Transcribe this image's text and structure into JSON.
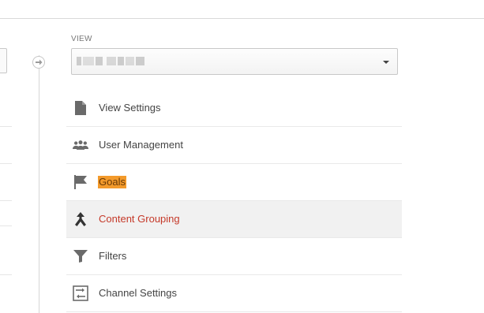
{
  "view": {
    "label": "VIEW",
    "selected_value_redacted": true
  },
  "menu": {
    "items": [
      {
        "label": "View Settings",
        "icon": "document-icon"
      },
      {
        "label": "User Management",
        "icon": "users-icon"
      },
      {
        "label": "Goals",
        "icon": "flag-icon",
        "highlighted": true
      },
      {
        "label": "Content Grouping",
        "icon": "content-grouping-icon",
        "selected": true
      },
      {
        "label": "Filters",
        "icon": "filter-icon"
      },
      {
        "label": "Channel Settings",
        "icon": "channel-settings-icon"
      }
    ]
  },
  "colors": {
    "active_text": "#c53929",
    "highlight": "#f39a2b",
    "icon": "#666666",
    "selected_bg": "#f1f1f1"
  }
}
